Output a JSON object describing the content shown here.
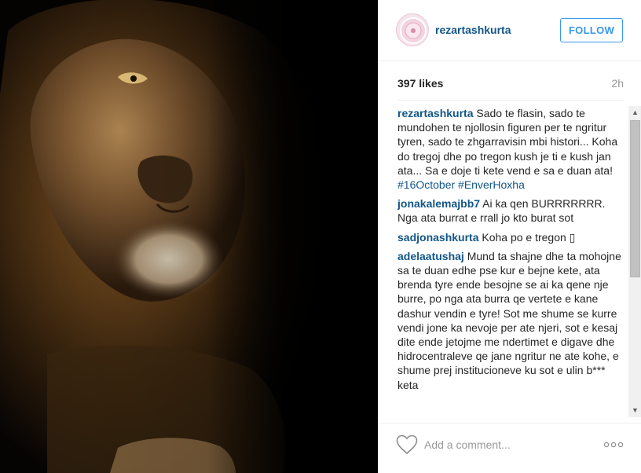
{
  "post": {
    "username": "rezartashkurta",
    "follow_label": "FOLLOW",
    "likes": "397 likes",
    "time_ago": "2h"
  },
  "comments": [
    {
      "user": "rezartashkurta",
      "text": " Sado te flasin, sado te mundohen te njollosin figuren per te ngritur tyren, sado te zhgarravisin mbi histori... Koha do tregoj dhe po tregon kush je ti e kush jan ata... Sa e doje ti kete vend e sa e duan ata!",
      "hashtags": "#16October #EnverHoxha"
    },
    {
      "user": "jonakalemajbb7",
      "text": " Ai ka qen BURRRRRRR. Nga ata burrat e rrall jo kto burat sot"
    },
    {
      "user": "sadjonashkurta",
      "text": " Koha po e tregon ▯"
    },
    {
      "user": "adelaatushaj",
      "text": " Mund ta shajne dhe ta mohojne sa te duan edhe pse kur e bejne kete, ata brenda tyre ende besojne se ai ka qene nje burre, po nga ata burra qe vertete e kane dashur vendin e tyre! Sot me shume se kurre vendi jone ka nevoje per ate njeri, sot e kesaj dite ende jetojme me ndertimet e digave dhe hidrocentraleve qe jane ngritur ne ate kohe, e shume prej institucioneve ku sot e ulin b*** keta"
    }
  ],
  "footer": {
    "comment_placeholder": "Add a comment..."
  },
  "icons": {
    "like": "heart-outline-icon",
    "more": "ellipsis-icon",
    "scroll_up": "scroll-up-arrow-icon",
    "scroll_down": "scroll-down-arrow-icon"
  },
  "colors": {
    "link": "#125688",
    "follow": "#3897f0",
    "muted": "#999999"
  }
}
